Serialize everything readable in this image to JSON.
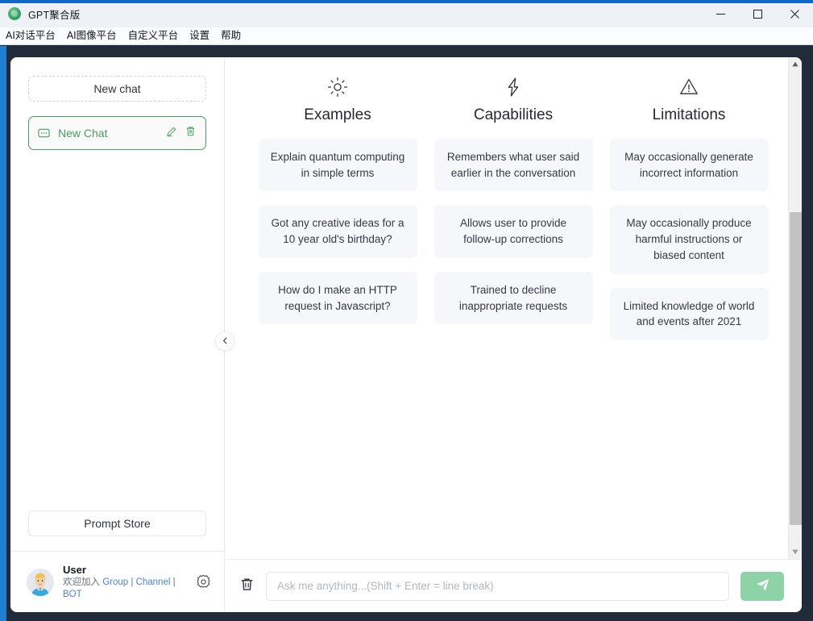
{
  "window": {
    "title": "GPT聚合版",
    "app_icon": "app-logo-icon",
    "controls": {
      "minimize": "–",
      "maximize": "☐",
      "close": "✕"
    }
  },
  "menubar": {
    "items": [
      {
        "label": "AI对话平台"
      },
      {
        "label": "AI图像平台"
      },
      {
        "label": "自定义平台"
      },
      {
        "label": "设置"
      },
      {
        "label": "帮助"
      }
    ]
  },
  "sidebar": {
    "new_chat_label": "New chat",
    "chats": [
      {
        "label": "New Chat",
        "icon": "chat-bubble-icon",
        "edit_icon": "pencil-icon",
        "delete_icon": "trash-icon",
        "selected": true
      }
    ],
    "prompt_store_label": "Prompt Store",
    "collapse_icon": "chevron-left-icon",
    "user": {
      "avatar": "user-avatar-icon",
      "name": "User",
      "welcome_prefix": "欢迎加入 ",
      "links": [
        {
          "label": "Group"
        },
        {
          "label": "Channel"
        },
        {
          "label": "BOT"
        }
      ],
      "link_separator": " | ",
      "settings_icon": "gear-icon"
    }
  },
  "main": {
    "columns": [
      {
        "icon": "sun-icon",
        "title": "Examples",
        "cards": [
          "Explain quantum computing in simple terms",
          "Got any creative ideas for a 10 year old's birthday?",
          "How do I make an HTTP request in Javascript?"
        ]
      },
      {
        "icon": "lightning-bolt-icon",
        "title": "Capabilities",
        "cards": [
          "Remembers what user said earlier in the conversation",
          "Allows user to provide follow-up corrections",
          "Trained to decline inappropriate requests"
        ]
      },
      {
        "icon": "warning-triangle-icon",
        "title": "Limitations",
        "cards": [
          "May occasionally generate incorrect information",
          "May occasionally produce harmful instructions or biased content",
          "Limited knowledge of world and events after 2021"
        ]
      }
    ],
    "scrollbar": {
      "up_icon": "scroll-up-arrow-icon",
      "down_icon": "scroll-down-arrow-icon"
    }
  },
  "composer": {
    "clear_icon": "trash-icon",
    "input_value": "",
    "input_placeholder": "Ask me anything...(Shift + Enter = line break)",
    "send_icon": "paper-plane-icon"
  },
  "colors": {
    "accent_green": "#4a9b63",
    "send_green": "#8ed3a8",
    "title_accent_blue": "#1068c9",
    "frame_dark": "#222b39",
    "left_edge_blue": "#1e7fd4",
    "card_bg": "#f5f7fa",
    "link_blue": "#4a7fe0"
  }
}
